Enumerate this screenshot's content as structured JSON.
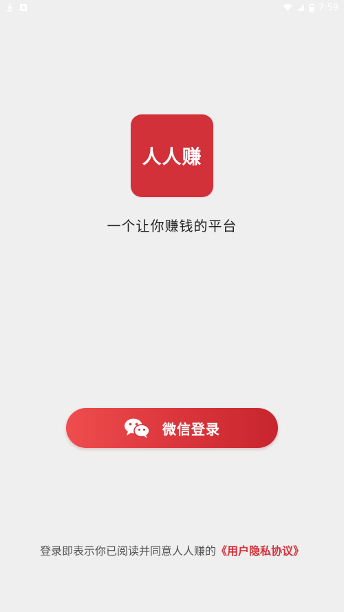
{
  "status_bar": {
    "left_icons": [
      "download-icon",
      "notification-icon"
    ],
    "right_icons": [
      "wifi-icon",
      "signal-icon",
      "battery-icon"
    ],
    "time": "7:59"
  },
  "logo": {
    "text": "人人赚"
  },
  "slogan": "一个让你赚钱的平台",
  "login_button": {
    "label": "微信登录",
    "icon": "wechat-icon"
  },
  "agreement": {
    "prefix": "登录即表示你已阅读并同意人人赚的",
    "link": "《用户隐私协议》"
  },
  "colors": {
    "background": "#efefef",
    "brand_red": "#d3313a",
    "text_dark": "#222222",
    "text_gray": "#555555"
  }
}
